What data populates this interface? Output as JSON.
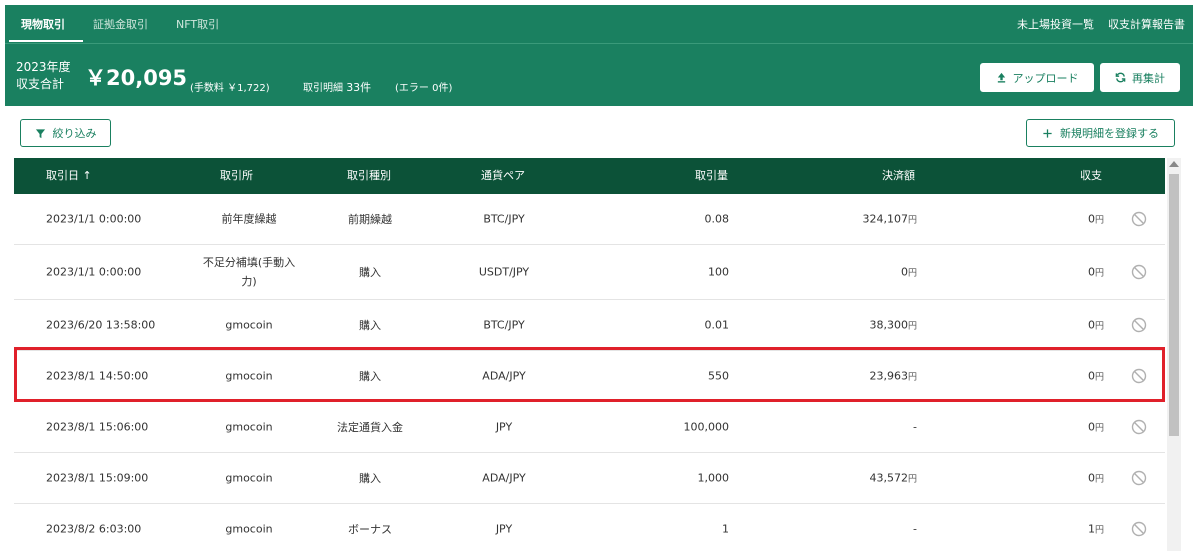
{
  "tabs": [
    {
      "label": "現物取引",
      "active": true
    },
    {
      "label": "証拠金取引",
      "active": false
    },
    {
      "label": "NFT取引",
      "active": false
    }
  ],
  "top_links": [
    "未上場投資一覧",
    "収支計算報告書"
  ],
  "summary": {
    "year_line1": "2023年度",
    "year_line2": "収支合計",
    "amount": "￥20,095",
    "fee": "(手数料 ￥1,722)",
    "detail_label": "取引明細",
    "detail_count": "33件",
    "error": "(エラー 0件)"
  },
  "buttons": {
    "upload": "アップロード",
    "recalc": "再集計",
    "filter": "絞り込み",
    "add": "新規明細を登録する"
  },
  "table": {
    "headers": {
      "date": "取引日 ↑",
      "exchange": "取引所",
      "type": "取引種別",
      "pair": "通貨ペア",
      "qty": "取引量",
      "settle": "決済額",
      "profit": "収支"
    },
    "unit": "円",
    "rows": [
      {
        "date": "2023/1/1 0:00:00",
        "exchange": "前年度繰越",
        "exchange2": "",
        "type": "前期繰越",
        "pair": "BTC/JPY",
        "qty": "0.08",
        "settle": "324,107",
        "settle_unit": "円",
        "profit": "0",
        "profit_unit": "円"
      },
      {
        "date": "2023/1/1 0:00:00",
        "exchange": "不足分補填(手動入",
        "exchange2": "力)",
        "type": "購入",
        "pair": "USDT/JPY",
        "qty": "100",
        "settle": "0",
        "settle_unit": "円",
        "profit": "0",
        "profit_unit": "円"
      },
      {
        "date": "2023/6/20 13:58:00",
        "exchange": "gmocoin",
        "exchange2": "",
        "type": "購入",
        "pair": "BTC/JPY",
        "qty": "0.01",
        "settle": "38,300",
        "settle_unit": "円",
        "profit": "0",
        "profit_unit": "円"
      },
      {
        "date": "2023/8/1 14:50:00",
        "exchange": "gmocoin",
        "exchange2": "",
        "type": "購入",
        "pair": "ADA/JPY",
        "qty": "550",
        "settle": "23,963",
        "settle_unit": "円",
        "profit": "0",
        "profit_unit": "円"
      },
      {
        "date": "2023/8/1 15:06:00",
        "exchange": "gmocoin",
        "exchange2": "",
        "type": "法定通貨入金",
        "pair": "JPY",
        "qty": "100,000",
        "settle": "-",
        "settle_unit": "",
        "profit": "0",
        "profit_unit": "円"
      },
      {
        "date": "2023/8/1 15:09:00",
        "exchange": "gmocoin",
        "exchange2": "",
        "type": "購入",
        "pair": "ADA/JPY",
        "qty": "1,000",
        "settle": "43,572",
        "settle_unit": "円",
        "profit": "0",
        "profit_unit": "円"
      },
      {
        "date": "2023/8/2 6:03:00",
        "exchange": "gmocoin",
        "exchange2": "",
        "type": "ボーナス",
        "pair": "JPY",
        "qty": "1",
        "settle": "-",
        "settle_unit": "",
        "profit": "1",
        "profit_unit": "円"
      }
    ]
  },
  "colors": {
    "header_bg": "#1a8060",
    "table_head_bg": "#0c5238",
    "highlight": "#e0202a"
  }
}
